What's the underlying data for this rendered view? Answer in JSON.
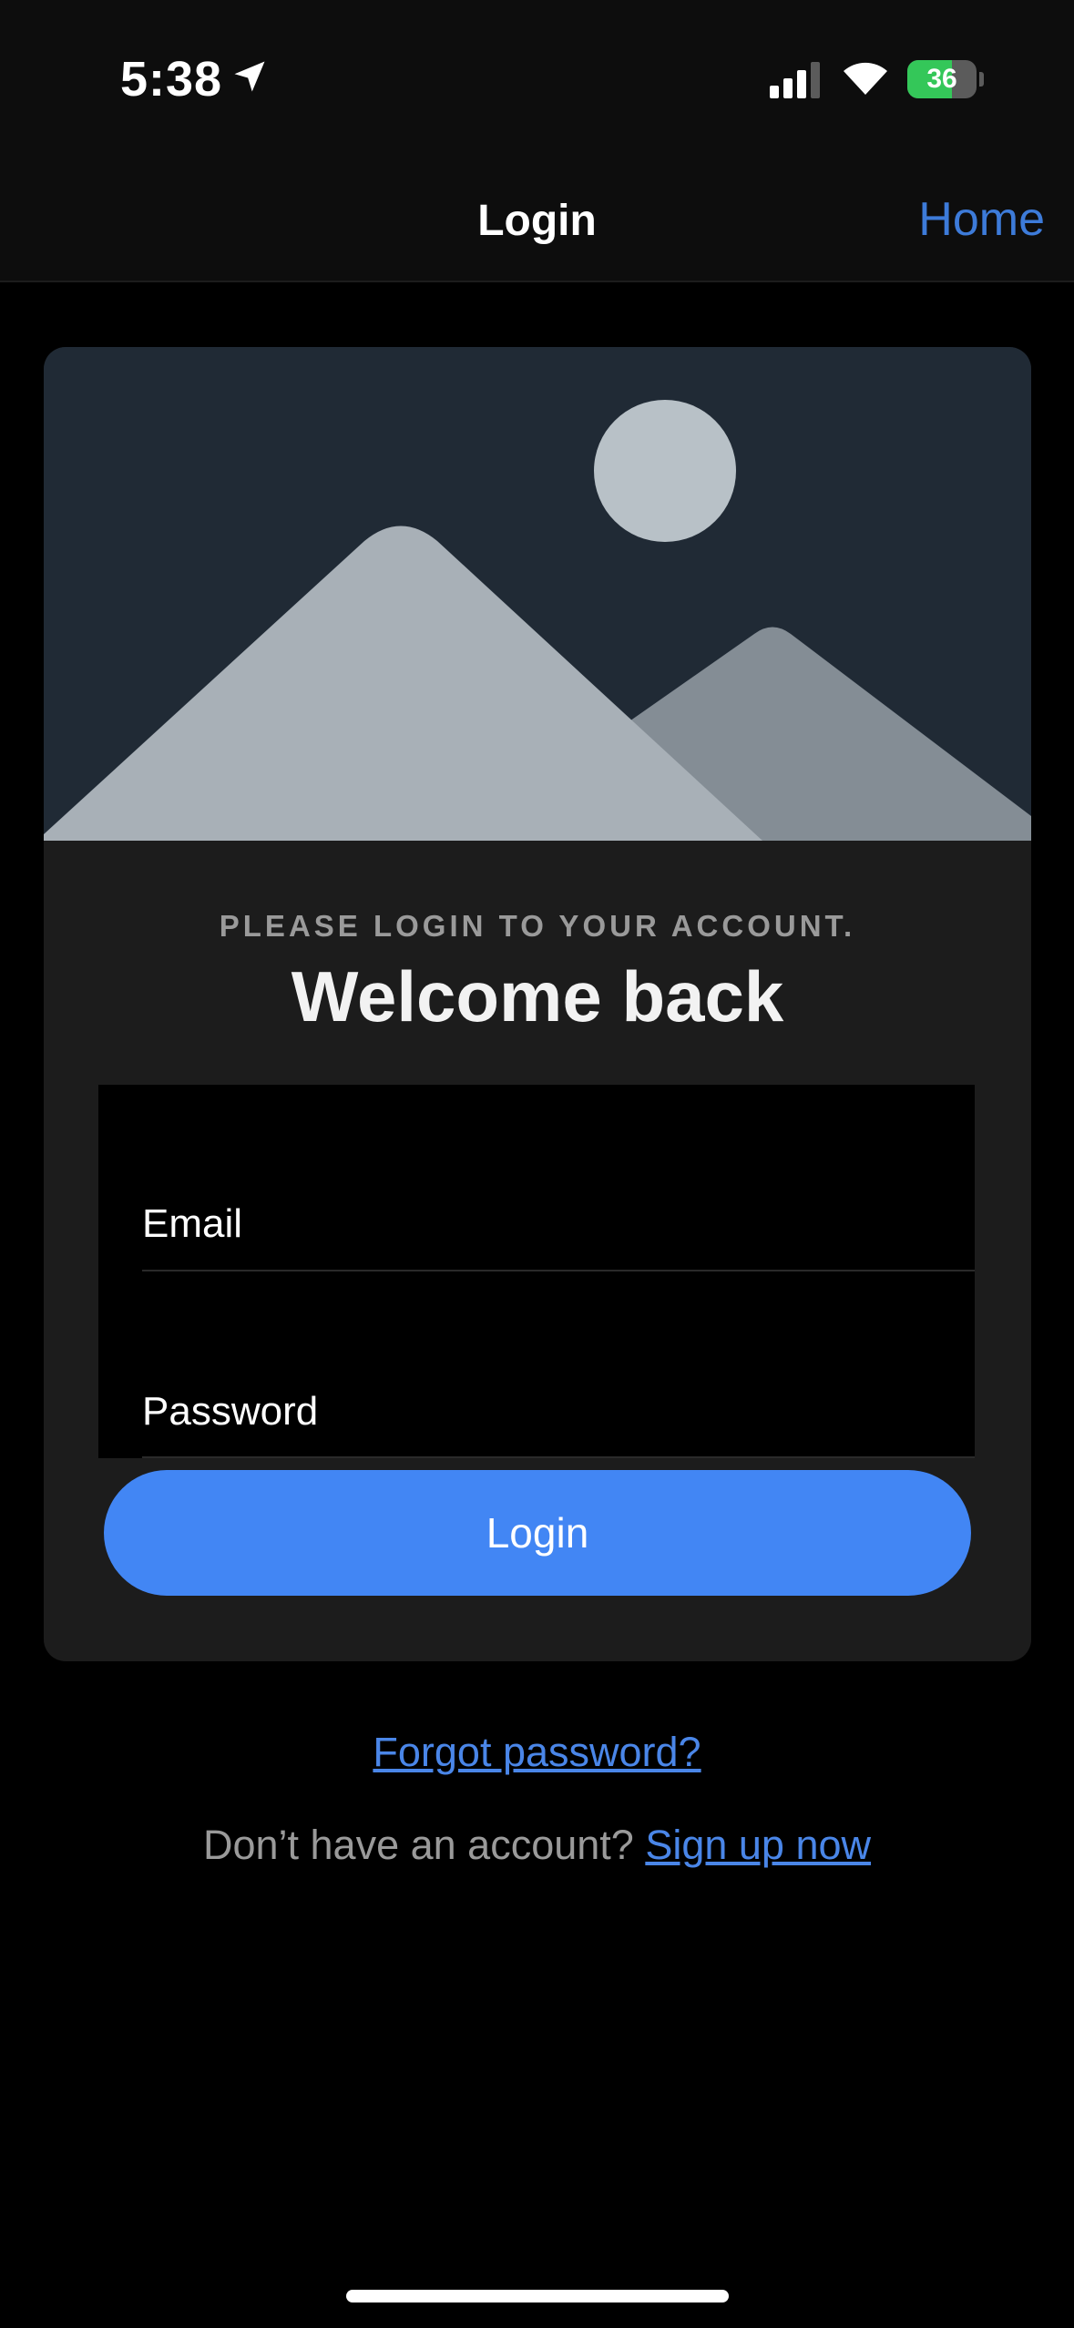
{
  "status_bar": {
    "time": "5:38",
    "battery_level": 36,
    "battery_text": "36",
    "battery_color": "#34c759",
    "icons": [
      "location-arrow-icon",
      "cellular-signal-icon",
      "wifi-icon",
      "battery-charging-icon"
    ]
  },
  "nav": {
    "title": "Login",
    "home_label": "Home",
    "accent_color": "#3d7bd9"
  },
  "card": {
    "hero_icon": "image-placeholder-icon",
    "subtitle": "PLEASE LOGIN TO YOUR ACCOUNT.",
    "heading": "Welcome back",
    "email_label": "Email",
    "password_label": "Password",
    "login_button": "Login",
    "button_color": "#4286f4"
  },
  "links": {
    "forgot_password": "Forgot password?",
    "no_account_text": "Don’t have an account?",
    "sign_up": "Sign up now",
    "link_color": "#4a86e8"
  }
}
